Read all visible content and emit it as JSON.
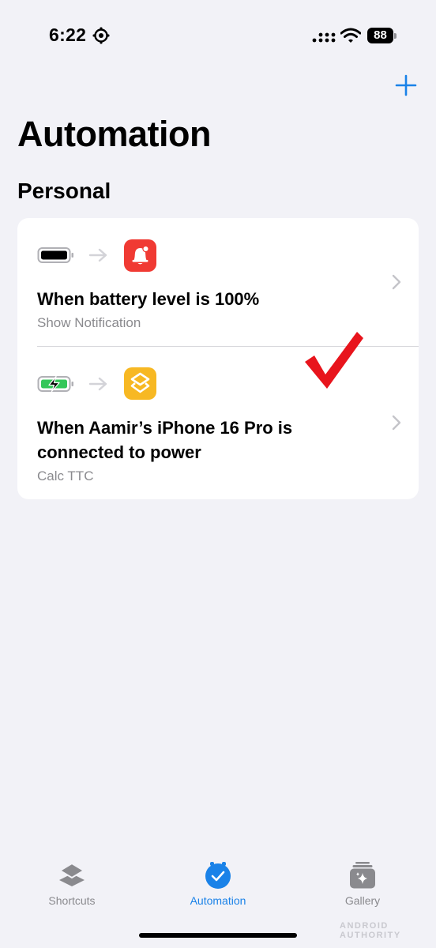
{
  "status_bar": {
    "time": "6:22",
    "battery_level": "88"
  },
  "header": {
    "title": "Automation",
    "add_icon": "plus-icon"
  },
  "section": {
    "title": "Personal"
  },
  "automations": [
    {
      "trigger_icon": "battery-full-icon",
      "action_icon": "notification-bell-icon",
      "title": "When battery level is 100%",
      "subtitle": "Show Notification"
    },
    {
      "trigger_icon": "battery-charging-icon",
      "action_icon": "shortcuts-icon",
      "title": "When Aamir’s iPhone 16 Pro is connected to power",
      "subtitle": "Calc TTC"
    }
  ],
  "tab_bar": {
    "tabs": [
      {
        "label": "Shortcuts",
        "icon": "shortcuts-layers-icon",
        "selected": false
      },
      {
        "label": "Automation",
        "icon": "automation-check-icon",
        "selected": true
      },
      {
        "label": "Gallery",
        "icon": "gallery-sparkle-icon",
        "selected": false
      }
    ]
  },
  "watermark": "ANDROID AUTHORITY",
  "colors": {
    "accent": "#1a82e8",
    "background": "#f2f2f7",
    "notification_red": "#f03a33",
    "shortcuts_yellow": "#f7b823",
    "charging_green": "#34c759",
    "annotation_check": "#e8141c"
  }
}
